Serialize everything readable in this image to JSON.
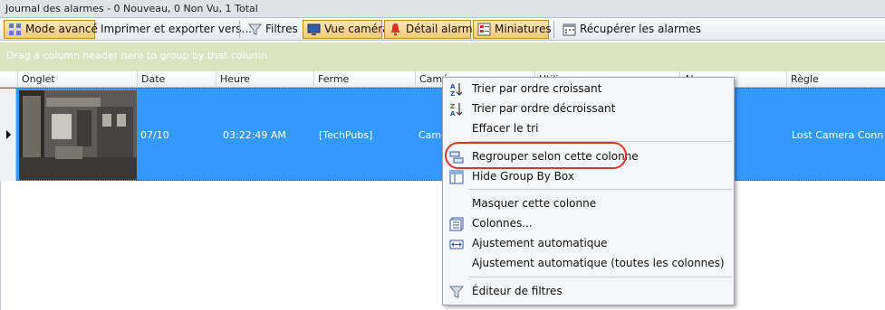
{
  "window": {
    "title": "Journal des alarmes - 0 Nouveau, 0 Non Vu, 1 Total"
  },
  "toolbar": {
    "advanced_mode": "Mode avancé",
    "print_export": "Imprimer et exporter vers...",
    "filters": "Filtres",
    "camera_view": "Vue caméra",
    "alarm_detail": "Détail alarme",
    "thumbnails": "Miniatures",
    "retrieve_alarms": "Récupérer les alarmes"
  },
  "group_box": {
    "hint": "Drag a column header here to group by that column"
  },
  "columns": [
    "Onglet",
    "Date",
    "Heure",
    "Ferme",
    "Camé",
    "Utilisa",
    "Ala",
    "Règle"
  ],
  "rows": [
    {
      "date": "07/10",
      "time": "03:22:49 AM",
      "farm": "[TechPubs]",
      "camera": "Came",
      "rule": "Lost Camera Conn..."
    }
  ],
  "context_menu": {
    "sort_asc": "Trier par ordre croissant",
    "sort_desc": "Trier par ordre décroissant",
    "clear_sort": "Effacer le tri",
    "group_by_column": "Regrouper selon cette colonne",
    "hide_group_box": "Hide Group By Box",
    "hide_column": "Masquer cette colonne",
    "columns": "Colonnes...",
    "auto_fit": "Ajustement automatique",
    "auto_fit_all": "Ajustement automatique (toutes les colonnes)",
    "filter_editor": "Éditeur de filtres"
  },
  "icons": {
    "advanced_mode": "grid-icon",
    "filters": "funnel-icon",
    "camera_view": "monitor-icon",
    "alarm_detail": "bell-icon",
    "thumbnails": "thumbnails-icon",
    "retrieve_alarms": "calendar-icon",
    "sort_asc": "sort-az-icon",
    "sort_desc": "sort-za-icon",
    "group_by": "group-icon",
    "hide_group_box": "groupbox-icon",
    "columns": "columns-icon",
    "auto_fit": "autofit-icon",
    "filter_editor": "funnel-icon"
  },
  "colors": {
    "selection": "#3399ff",
    "active_button": "#fbc77b",
    "group_box": "#d9e5c1",
    "annotation_ring": "#d43a2a"
  }
}
